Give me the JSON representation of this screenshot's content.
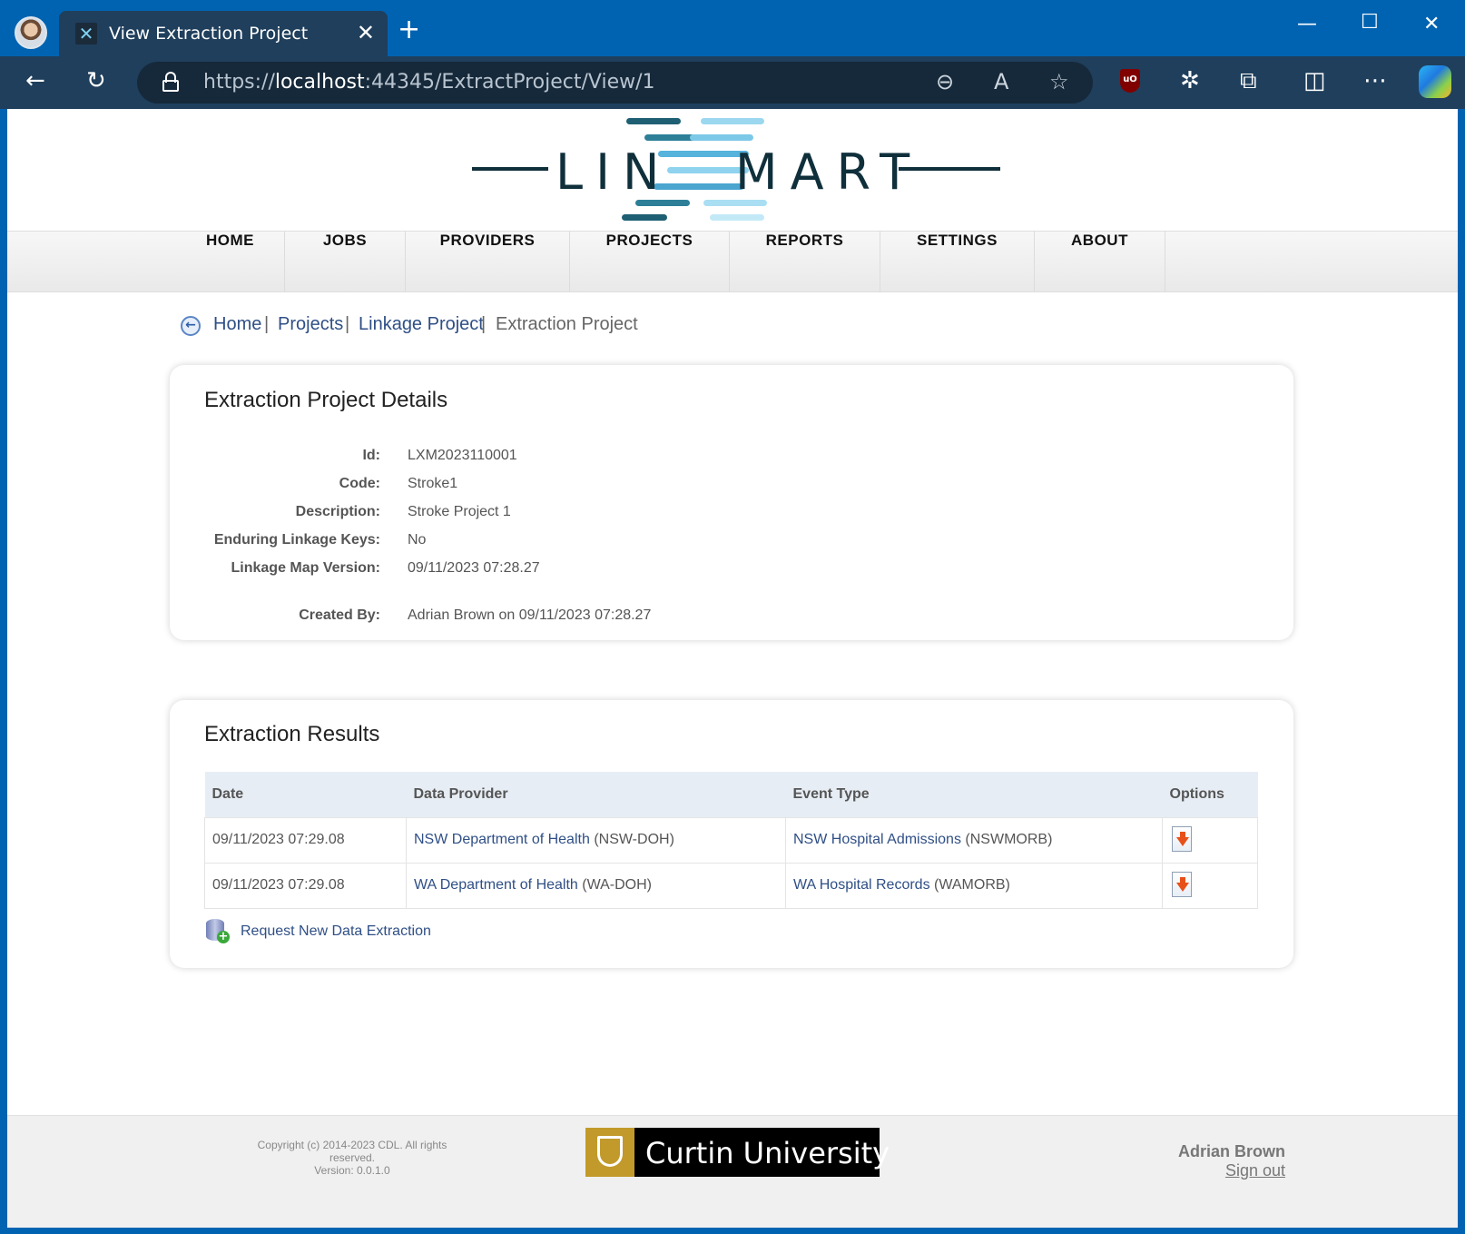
{
  "browser": {
    "tab_title": "View Extraction Project",
    "url_scheme": "https://",
    "url_host": "localhost",
    "url_rest": ":44345/ExtractProject/View/1",
    "ublock_label": "uO"
  },
  "nav": {
    "items": [
      "HOME",
      "JOBS",
      "PROVIDERS",
      "PROJECTS",
      "REPORTS",
      "SETTINGS",
      "ABOUT"
    ]
  },
  "logo": {
    "left_text": "LIN",
    "right_text": "MART"
  },
  "breadcrumb": {
    "home": "Home",
    "projects": "Projects",
    "linkage": "Linkage Project",
    "current": "Extraction Project",
    "separator": "|"
  },
  "details": {
    "title": "Extraction Project Details",
    "id_label": "Id:",
    "id_value": "LXM2023110001",
    "code_label": "Code:",
    "code_value": "Stroke1",
    "description_label": "Description:",
    "description_value": "Stroke Project 1",
    "enduring_label": "Enduring Linkage Keys:",
    "enduring_value": "No",
    "map_version_label": "Linkage Map Version:",
    "map_version_value": "09/11/2023 07:28.27",
    "created_by_label": "Created By:",
    "created_by_value": "Adrian Brown on 09/11/2023 07:28.27"
  },
  "results": {
    "title": "Extraction Results",
    "headers": [
      "Date",
      "Data Provider",
      "Event Type",
      "Options"
    ],
    "rows": [
      {
        "date": "09/11/2023 07:29.08",
        "provider_name": "NSW Department of Health",
        "provider_code": "(NSW-DOH)",
        "event_name": "NSW Hospital Admissions",
        "event_code": "(NSWMORB)"
      },
      {
        "date": "09/11/2023 07:29.08",
        "provider_name": "WA Department of Health",
        "provider_code": "(WA-DOH)",
        "event_name": "WA Hospital Records",
        "event_code": "(WAMORB)"
      }
    ],
    "request_link": "Request New Data Extraction"
  },
  "footer": {
    "copyright": "Copyright (c) 2014-2023 CDL. All rights reserved.",
    "version": "Version: 0.0.1.0",
    "university": "Curtin University",
    "user_name": "Adrian Brown",
    "sign_out": "Sign out"
  },
  "colors": {
    "titlebar": "#0063b1",
    "toolbar": "#1f3f5c",
    "link": "#2f4f86",
    "table_header": "#e7edf4",
    "curtin_gold": "#c29a2b"
  }
}
